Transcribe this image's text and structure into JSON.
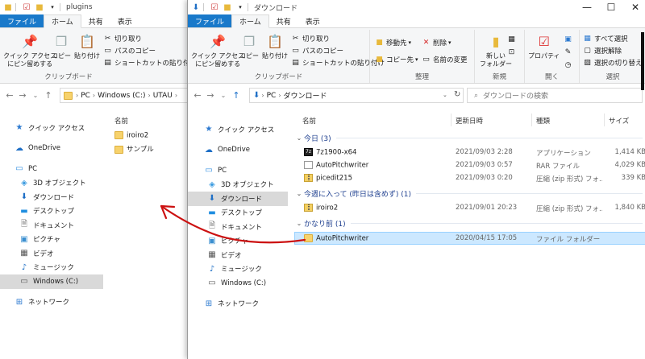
{
  "left_window": {
    "title": "plugins",
    "tabs": [
      "ファイル",
      "ホーム",
      "共有",
      "表示"
    ],
    "ribbon": {
      "pin_label_1": "クイック アクセス",
      "pin_label_2": "にピン留めする",
      "copy": "コピー",
      "paste": "貼り付け",
      "cut": "切り取り",
      "copy_path": "パスのコピー",
      "paste_shortcut": "ショートカットの貼り付け",
      "group_clipboard": "クリップボード"
    },
    "address": {
      "crumbs": [
        "PC",
        "Windows (C:)",
        "UTAU"
      ]
    },
    "nav": [
      "クイック アクセス",
      "OneDrive",
      "PC",
      "3D オブジェクト",
      "ダウンロード",
      "デスクトップ",
      "ドキュメント",
      "ピクチャ",
      "ビデオ",
      "ミュージック",
      "Windows (C:)",
      "ネットワーク"
    ],
    "column_name": "名前",
    "files": [
      "iroiro2",
      "サンプル"
    ]
  },
  "right_window": {
    "title": "ダウンロード",
    "tabs": [
      "ファイル",
      "ホーム",
      "共有",
      "表示"
    ],
    "ribbon": {
      "pin_label_1": "クイック アクセス",
      "pin_label_2": "にピン留めする",
      "copy": "コピー",
      "paste": "貼り付け",
      "cut": "切り取り",
      "copy_path": "パスのコピー",
      "paste_shortcut": "ショートカットの貼り付け",
      "group_clipboard": "クリップボード",
      "move_to": "移動先",
      "copy_to": "コピー先",
      "delete": "削除",
      "rename": "名前の変更",
      "group_organize": "整理",
      "new_folder_1": "新しい",
      "new_folder_2": "フォルダー",
      "group_new": "新規",
      "properties": "プロパティ",
      "group_open": "開く",
      "select_all": "すべて選択",
      "select_none": "選択解除",
      "invert_selection": "選択の切り替え",
      "group_select": "選択"
    },
    "address": {
      "crumbs": [
        "PC",
        "ダウンロード"
      ],
      "search_placeholder": "ダウンロードの検索"
    },
    "nav": [
      "クイック アクセス",
      "OneDrive",
      "PC",
      "3D オブジェクト",
      "ダウンロード",
      "デスクトップ",
      "ドキュメント",
      "ピクチャ",
      "ビデオ",
      "ミュージック",
      "Windows (C:)",
      "ネットワーク"
    ],
    "columns": {
      "name": "名前",
      "date": "更新日時",
      "type": "種類",
      "size": "サイズ"
    },
    "groups": [
      {
        "label": "今日 (3)",
        "rows": [
          {
            "name": "7z1900-x64",
            "date": "2021/09/03 2:28",
            "type": "アプリケーション",
            "size": "1,414 KB",
            "icon": "exe"
          },
          {
            "name": "AutoPitchwriter",
            "date": "2021/09/03 0:57",
            "type": "RAR ファイル",
            "size": "4,029 KB",
            "icon": "file"
          },
          {
            "name": "picedit215",
            "date": "2021/09/03 0:20",
            "type": "圧縮 (zip 形式) フォ...",
            "size": "339 KB",
            "icon": "zip"
          }
        ]
      },
      {
        "label": "今週に入って (昨日は含めず) (1)",
        "rows": [
          {
            "name": "iroiro2",
            "date": "2021/09/01 20:23",
            "type": "圧縮 (zip 形式) フォ...",
            "size": "1,840 KB",
            "icon": "zip"
          }
        ]
      },
      {
        "label": "かなり前 (1)",
        "rows": [
          {
            "name": "AutoPitchwriter",
            "date": "2020/04/15 17:05",
            "type": "ファイル フォルダー",
            "size": "",
            "icon": "folder"
          }
        ]
      }
    ]
  },
  "colors": {
    "file_tab": "#1979ca",
    "selection": "#cce8ff",
    "annotation_arrow": "#cc1111"
  }
}
